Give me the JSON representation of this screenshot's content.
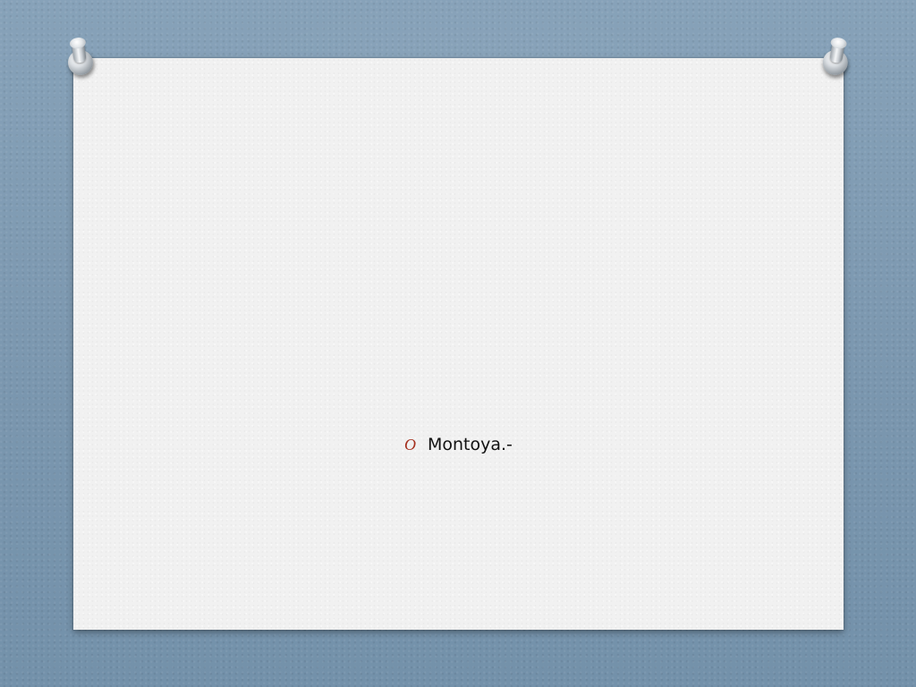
{
  "slide": {
    "bullet_marker": "O",
    "bullet_text": "Montoya.-"
  },
  "colors": {
    "background": "#7f9bb4",
    "card": "#f1f1f1",
    "bullet_accent": "#a5301f",
    "text": "#111111"
  },
  "icons": {
    "left_pin": "pushpin-icon",
    "right_pin": "pushpin-icon"
  }
}
